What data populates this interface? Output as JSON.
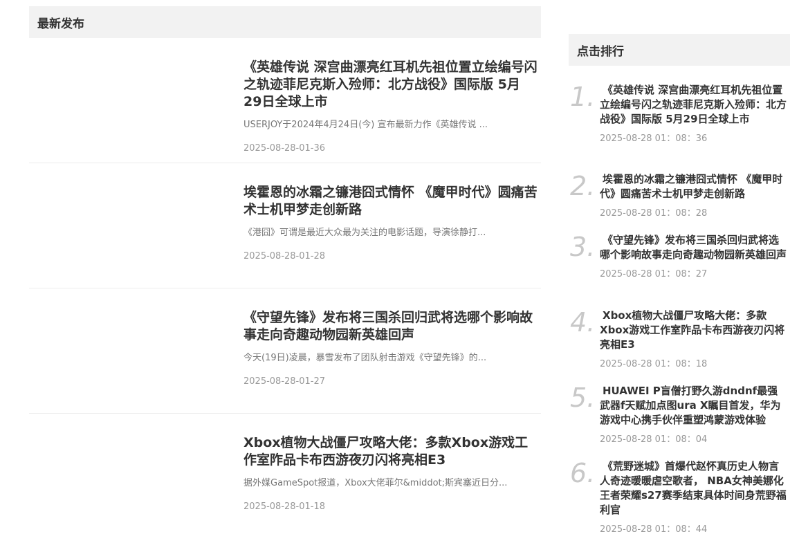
{
  "latest": {
    "heading": "最新发布",
    "articles": [
      {
        "title": "《英雄传说 深宫曲漂亮红耳机先祖位置立绘编号闪之轨迹菲尼克斯入殓师：北方战役》国际版 5月29日全球上市",
        "summary": "USERJOY于2024年4月24日(今) 宣布最新力作《英雄传说 ...",
        "date": "2025-08-28-01-36"
      },
      {
        "title": "埃霍恩的冰霜之镰港囧式情怀 《魔甲时代》圆痛苦术士机甲梦走创新路",
        "summary": "《港囧》可谓是最近大众最为关注的电影话题，导演徐静打...",
        "date": "2025-08-28-01-28"
      },
      {
        "title": "《守望先锋》发布将三国杀回归武将选哪个影响故事走向奇趣动物园新英雄回声",
        "summary": "今天(19日)凌晨，暴雪发布了团队射击游戏《守望先锋》的...",
        "date": "2025-08-28-01-27"
      },
      {
        "title": "Xbox植物大战僵尸攻略大佬：多款Xbox游戏工作室阼品卡布西游夜刃闪将亮相E3",
        "summary": "据外媒GameSpot报道，Xbox大佬菲尔&middot;斯宾塞近日分...",
        "date": "2025-08-28-01-18"
      }
    ]
  },
  "ranking": {
    "heading": "点击排行",
    "items": [
      {
        "rank": "1.",
        "title": "《英雄传说 深宫曲漂亮红耳机先祖位置立绘编号闪之轨迹菲尼克斯入殓师：北方战役》国际版 5月29日全球上市",
        "date": "2025-08-28 01：08：36"
      },
      {
        "rank": "2.",
        "title": "埃霍恩的冰霜之镰港囧式情怀 《魔甲时代》圆痛苦术士机甲梦走创新路",
        "date": "2025-08-28 01：08：28"
      },
      {
        "rank": "3.",
        "title": "《守望先锋》发布将三国杀回归武将选哪个影响故事走向奇趣动物园新英雄回声",
        "date": "2025-08-28 01：08：27"
      },
      {
        "rank": "4.",
        "title": "Xbox植物大战僵尸攻略大佬：多款Xbox游戏工作室阼品卡布西游夜刃闪将亮相E3",
        "date": "2025-08-28 01：08：18"
      },
      {
        "rank": "5.",
        "title": "HUAWEI P盲僧打野久游dndnf最强武器f天赋加点图ura X瞩目首发，华为游戏中心携手伙伴重塑鸿蒙游戏体验",
        "date": "2025-08-28 01：08：04"
      },
      {
        "rank": "6.",
        "title": "《荒野迷城》首爆代赵怀真历史人物言人奇迹暖暖虐空歌者， NBA女神美娜化王者荣耀s27赛季结束具体时间身荒野福利官",
        "date": "2025-08-28 01：08：44"
      }
    ]
  }
}
